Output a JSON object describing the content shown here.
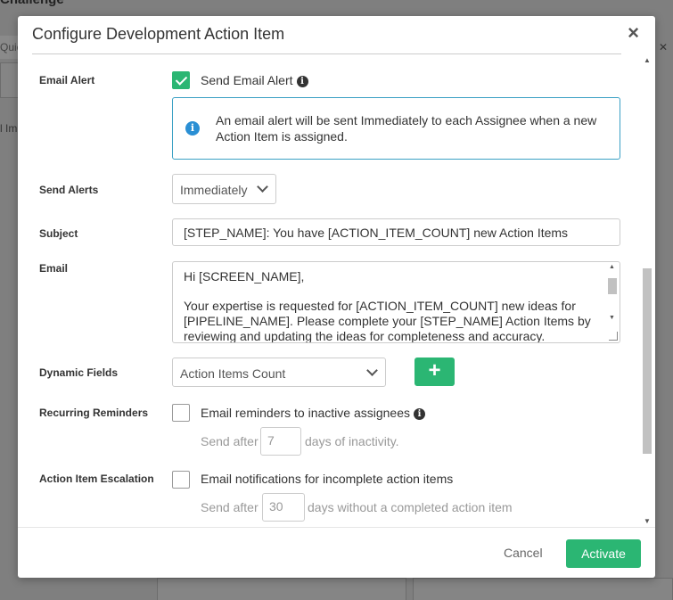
{
  "background": {
    "page_title": "Challenge",
    "tab_fragment": "Quic",
    "side_fragment": "l Im"
  },
  "modal": {
    "title": "Configure Development Action Item",
    "close_glyph": "×"
  },
  "form": {
    "email_alert": {
      "label": "Email Alert",
      "checkbox_label": "Send Email Alert",
      "checked": true,
      "info_text": "An email alert will be sent Immediately to each Assignee when a new Action Item is assigned."
    },
    "send_alerts": {
      "label": "Send Alerts",
      "selected": "Immediately"
    },
    "subject": {
      "label": "Subject",
      "value": "[STEP_NAME]: You have [ACTION_ITEM_COUNT] new Action Items"
    },
    "email": {
      "label": "Email",
      "line1": "Hi [SCREEN_NAME],",
      "line2": "Your expertise is requested for [ACTION_ITEM_COUNT] new ideas for [PIPELINE_NAME]. Please complete your [STEP_NAME] Action Items by reviewing and updating the ideas for completeness and accuracy."
    },
    "dynamic_fields": {
      "label": "Dynamic Fields",
      "selected": "Action Items Count",
      "add_glyph": "+"
    },
    "recurring_reminders": {
      "label": "Recurring Reminders",
      "checkbox_label": "Email reminders to inactive assignees",
      "checked": false,
      "prefix": "Send after",
      "days": "7",
      "suffix": "days of inactivity."
    },
    "escalation": {
      "label": "Action Item Escalation",
      "checkbox_label": "Email notifications for incomplete action items",
      "checked": false,
      "prefix": "Send after",
      "days": "30",
      "suffix": "days without a completed action item"
    }
  },
  "footer": {
    "cancel_label": "Cancel",
    "activate_label": "Activate"
  },
  "colors": {
    "accent_green": "#2bb673",
    "info_blue": "#2a8fd4"
  }
}
